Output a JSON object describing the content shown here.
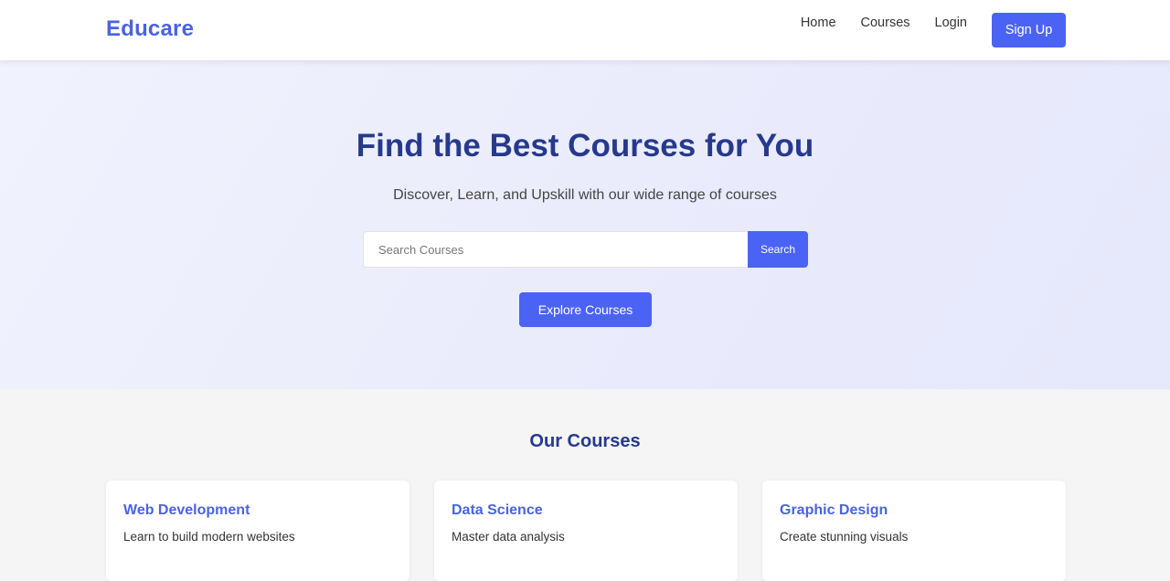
{
  "header": {
    "brand": "Educare",
    "nav": {
      "home": "Home",
      "courses": "Courses",
      "login": "Login",
      "signup": "Sign Up"
    }
  },
  "hero": {
    "title": "Find the Best Courses for You",
    "subtitle": "Discover, Learn, and Upskill with our wide range of courses",
    "search": {
      "placeholder": "Search Courses",
      "value": "",
      "button": "Search"
    },
    "explore_button": "Explore Courses"
  },
  "courses": {
    "title": "Our Courses",
    "items": [
      {
        "title": "Web Development",
        "description": "Learn to build modern websites"
      },
      {
        "title": "Data Science",
        "description": "Master data analysis"
      },
      {
        "title": "Graphic Design",
        "description": "Create stunning visuals"
      }
    ]
  },
  "colors": {
    "brand": "#4a63e0",
    "primary_button": "#4a63f5",
    "heading": "#263a8c",
    "hero_background": "#eceefc",
    "section_background": "#f5f5f5"
  }
}
